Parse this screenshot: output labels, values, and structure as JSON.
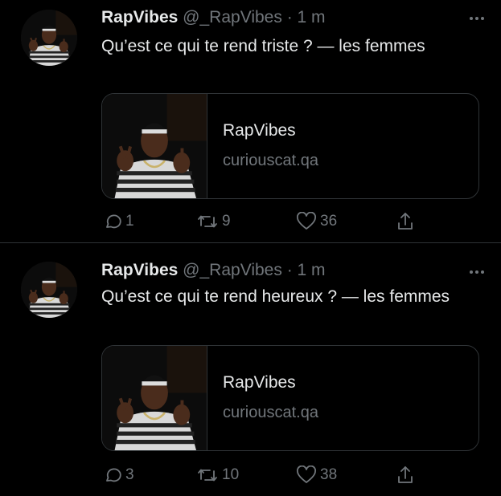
{
  "tweets": [
    {
      "name": "RapVibes",
      "handle": "@_RapVibes",
      "separator": "·",
      "time": "1 m",
      "text": "Qu’est ce qui te rend triste ? — les femmes",
      "card": {
        "title": "RapVibes",
        "domain": "curiouscat.qa"
      },
      "replies": "1",
      "retweets": "9",
      "likes": "36"
    },
    {
      "name": "RapVibes",
      "handle": "@_RapVibes",
      "separator": "·",
      "time": "1 m",
      "text": "Qu’est ce qui te rend heureux ? — les femmes",
      "card": {
        "title": "RapVibes",
        "domain": "curiouscat.qa"
      },
      "replies": "3",
      "retweets": "10",
      "likes": "38"
    }
  ],
  "icons": {
    "more": "more-dots-icon",
    "reply": "reply-icon",
    "retweet": "retweet-icon",
    "like": "heart-icon",
    "share": "share-icon"
  },
  "colors": {
    "background": "#000000",
    "text": "#e7e9ea",
    "muted": "#71767b",
    "border": "#2f3336"
  }
}
